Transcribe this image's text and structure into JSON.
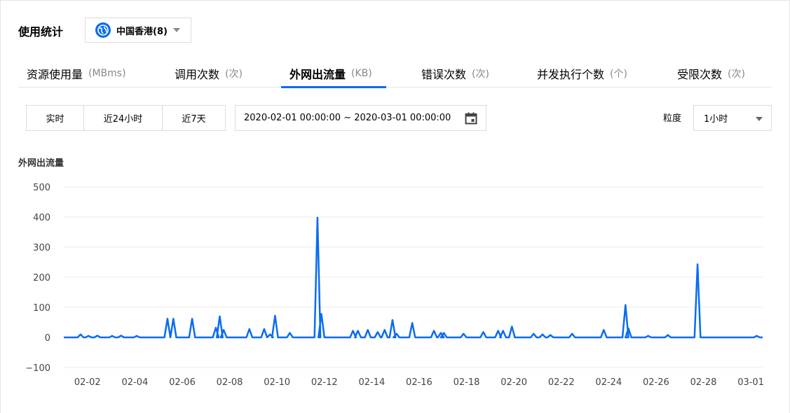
{
  "header": {
    "title": "使用统计",
    "region_label": "中国香港(8)"
  },
  "tabs": [
    {
      "label": "资源使用量",
      "unit": "(MBms)"
    },
    {
      "label": "调用次数",
      "unit": "(次)"
    },
    {
      "label": "外网出流量",
      "unit": "(KB)",
      "active": true
    },
    {
      "label": "错误次数",
      "unit": "(次)"
    },
    {
      "label": "并发执行个数",
      "unit": "(个)"
    },
    {
      "label": "受限次数",
      "unit": "(次)"
    }
  ],
  "time_buttons": [
    "实时",
    "近24小时",
    "近7天"
  ],
  "date_range": "2020-02-01 00:00:00 ~ 2020-03-01 00:00:00",
  "granularity": {
    "label": "粒度",
    "value": "1小时"
  },
  "icons": {
    "region": "globe-icon",
    "date": "calendar-icon",
    "dropdown": "caret-down-icon"
  },
  "colors": {
    "accent": "#0a6cf0",
    "line": "#0a6cf0"
  },
  "chart_data": {
    "type": "line",
    "title": "外网出流量",
    "ylim": [
      -100,
      500
    ],
    "yticks": [
      500,
      400,
      300,
      200,
      100,
      0,
      -100
    ],
    "xlim": [
      "2020-02-01 00:00",
      "2020-03-01 12:00"
    ],
    "xticks": [
      "02-02",
      "02-04",
      "02-06",
      "02-08",
      "02-10",
      "02-12",
      "02-14",
      "02-16",
      "02-18",
      "02-20",
      "02-22",
      "02-24",
      "02-26",
      "02-28",
      "03-01"
    ],
    "grid": true,
    "series": [
      {
        "baseline": 0,
        "points": [
          [
            "2020-02-01 17:00",
            10
          ],
          [
            "2020-02-02 01:00",
            5
          ],
          [
            "2020-02-02 10:00",
            6
          ],
          [
            "2020-02-03 01:00",
            5
          ],
          [
            "2020-02-03 10:00",
            6
          ],
          [
            "2020-02-04 02:00",
            5
          ],
          [
            "2020-02-05 09:00",
            62
          ],
          [
            "2020-02-05 15:00",
            62
          ],
          [
            "2020-02-06 10:00",
            62
          ],
          [
            "2020-02-07 10:00",
            32
          ],
          [
            "2020-02-07 14:00",
            70
          ],
          [
            "2020-02-07 18:00",
            25
          ],
          [
            "2020-02-08 20:00",
            28
          ],
          [
            "2020-02-09 11:00",
            28
          ],
          [
            "2020-02-09 17:00",
            10
          ],
          [
            "2020-02-09 22:00",
            72
          ],
          [
            "2020-02-10 13:00",
            15
          ],
          [
            "2020-02-11 17:00",
            398
          ],
          [
            "2020-02-11 21:00",
            78
          ],
          [
            "2020-02-13 05:00",
            22
          ],
          [
            "2020-02-13 10:00",
            22
          ],
          [
            "2020-02-13 20:00",
            25
          ],
          [
            "2020-02-14 06:00",
            18
          ],
          [
            "2020-02-14 13:00",
            25
          ],
          [
            "2020-02-14 21:00",
            58
          ],
          [
            "2020-02-15 01:00",
            12
          ],
          [
            "2020-02-15 17:00",
            48
          ],
          [
            "2020-02-16 15:00",
            22
          ],
          [
            "2020-02-16 22:00",
            15
          ],
          [
            "2020-02-17 01:00",
            15
          ],
          [
            "2020-02-17 21:00",
            12
          ],
          [
            "2020-02-18 17:00",
            18
          ],
          [
            "2020-02-19 08:00",
            22
          ],
          [
            "2020-02-19 13:00",
            22
          ],
          [
            "2020-02-19 22:00",
            36
          ],
          [
            "2020-02-20 20:00",
            12
          ],
          [
            "2020-02-21 05:00",
            10
          ],
          [
            "2020-02-21 13:00",
            8
          ],
          [
            "2020-02-22 11:00",
            12
          ],
          [
            "2020-02-23 19:00",
            25
          ],
          [
            "2020-02-24 17:00",
            108
          ],
          [
            "2020-02-24 20:00",
            30
          ],
          [
            "2020-02-25 16:00",
            5
          ],
          [
            "2020-02-26 12:00",
            8
          ],
          [
            "2020-02-27 18:00",
            243
          ],
          [
            "2020-03-01 06:00",
            5
          ]
        ]
      }
    ]
  }
}
